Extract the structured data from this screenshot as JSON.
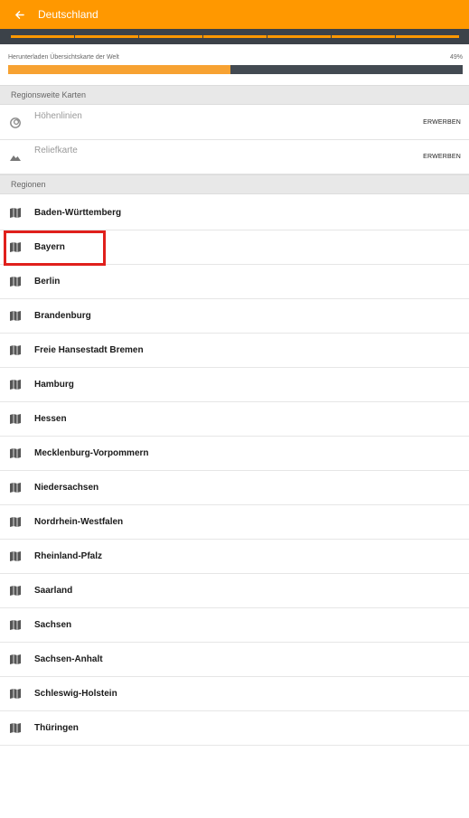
{
  "appbar": {
    "title": "Deutschland",
    "back_icon": "arrow-left-icon",
    "color": "#ff9800"
  },
  "storage": {
    "color": "#ff9800"
  },
  "download": {
    "label": "Herunterladen Übersichtskarte der Welt",
    "percent_text": "49%",
    "progress": 0.49
  },
  "regional_maps": {
    "header": "Regionsweite Karten",
    "items": [
      {
        "label": "Höhenlinien",
        "action": "ERWERBEN",
        "icon": "contour-lines-icon"
      },
      {
        "label": "Reliefkarte",
        "action": "ERWERBEN",
        "icon": "mountain-relief-icon"
      }
    ]
  },
  "regions": {
    "header": "Regionen",
    "icon": "map-icon",
    "items": [
      "Baden-Württemberg",
      "Bayern",
      "Berlin",
      "Brandenburg",
      "Freie Hansestadt Bremen",
      "Hamburg",
      "Hessen",
      "Mecklenburg-Vorpommern",
      "Niedersachsen",
      "Nordrhein-Westfalen",
      "Rheinland-Pfalz",
      "Saarland",
      "Sachsen",
      "Sachsen-Anhalt",
      "Schleswig-Holstein",
      "Thüringen"
    ],
    "highlighted": "Bayern",
    "highlight_color": "#e0201c"
  }
}
